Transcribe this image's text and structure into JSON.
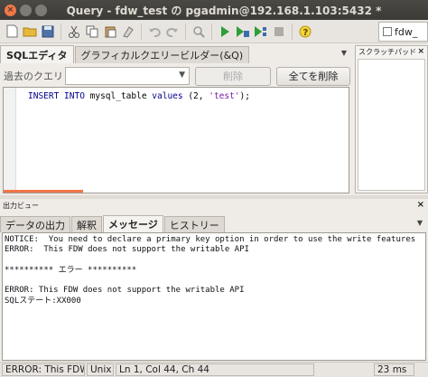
{
  "window": {
    "title": "Query - fdw_test の pgadmin@192.168.1.103:5432 *"
  },
  "toolbar": {
    "icons": [
      "new-file-icon",
      "open-folder-icon",
      "save-icon",
      "cut-icon",
      "copy-icon",
      "paste-icon",
      "clear-icon",
      "undo-icon",
      "redo-icon",
      "find-icon",
      "execute-icon",
      "execute-to-file-icon",
      "explain-icon",
      "stop-icon",
      "help-icon"
    ],
    "right_label": "fdw_"
  },
  "query_tabs": [
    {
      "label": "SQLエディタ"
    },
    {
      "label": "グラフィカルクエリービルダー(&Q)"
    }
  ],
  "scratchpad": {
    "title": "スクラッチパッド"
  },
  "past": {
    "label": "過去のクエリ",
    "selected": "",
    "delete_label": "削除",
    "delete_all_label": "全てを削除"
  },
  "editor": {
    "line1": {
      "kw1": "INSERT INTO",
      "t1": " mysql_table ",
      "kw2": "values",
      "t2": " (2, ",
      "str": "'test'",
      "t3": ");"
    }
  },
  "output": {
    "pane_title": "出力ビュー",
    "tabs": [
      {
        "label": "データの出力"
      },
      {
        "label": "解釈"
      },
      {
        "label": "メッセージ"
      },
      {
        "label": "ヒストリー"
      }
    ],
    "messages": [
      "NOTICE:  You need to declare a primary key option in order to use the write features",
      "ERROR:  This FDW does not support the writable API",
      "",
      "********** エラー **********",
      "",
      "ERROR: This FDW does not support the writable API",
      "SQLステート:XX000"
    ]
  },
  "status": {
    "message": "ERROR: This FDW",
    "eol": "Unix",
    "position": "Ln 1, Col 44, Ch 44",
    "timing": "23 ms"
  },
  "colors": {
    "titlebar": "#3c3b37",
    "close": "#f07746",
    "accent": "#f07746"
  }
}
